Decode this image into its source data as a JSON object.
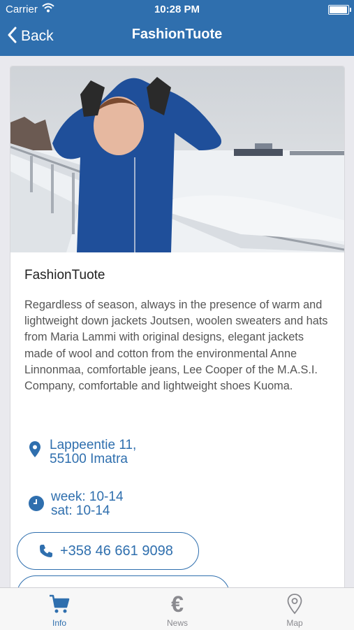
{
  "status_bar": {
    "carrier": "Carrier",
    "time": "10:28 PM",
    "battery_level": 0.95
  },
  "nav": {
    "back_label": "Back",
    "title": "FashionTuote"
  },
  "card": {
    "title": "FashionTuote",
    "description": "Regardless of season, always in the presence of warm and lightweight down jackets Joutsen, woolen sweaters and hats from Maria Lammi with original designs, elegant jackets made of wool and cotton from the environmental Anne Linnonmaa, comfortable jeans, Lee Cooper of the M.A.S.I. Company, comfortable and lightweight shoes Kuoma.",
    "address_line1": "Lappeentie 11,",
    "address_line2": "55100 Imatra",
    "hours_line1": "week: 10-14",
    "hours_line2": "sat: 10-14",
    "phone": "+358 46 661 9098"
  },
  "tabs": [
    {
      "label": "Info",
      "icon": "cart-icon",
      "active": true
    },
    {
      "label": "News",
      "icon": "euro-icon",
      "active": false
    },
    {
      "label": "Map",
      "icon": "map-pin-icon",
      "active": false
    }
  ],
  "colors": {
    "brand": "#2f6fae",
    "tab_inactive": "#8a8a8f"
  }
}
